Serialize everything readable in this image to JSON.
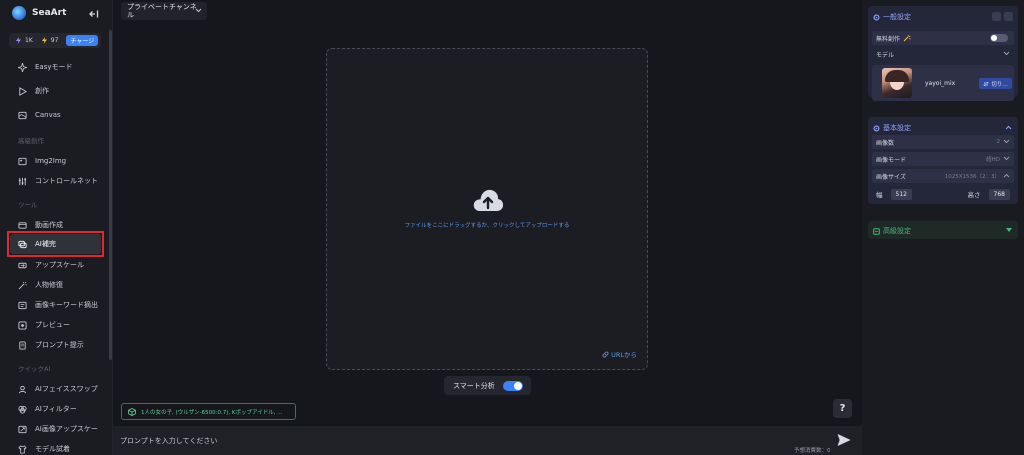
{
  "sidebar": {
    "brand": "SeaArt",
    "stats": {
      "stamina": "1K",
      "energy": "97",
      "charge_label": "チャージ"
    },
    "items": [
      {
        "label": "Easyモード"
      },
      {
        "label": "創作"
      },
      {
        "label": "Canvas"
      },
      {
        "label": "Img2Img"
      },
      {
        "label": "コントロールネット"
      },
      {
        "label": "動画作成"
      },
      {
        "label": "AI補完"
      },
      {
        "label": "アップスケール"
      },
      {
        "label": "人物修復"
      },
      {
        "label": "画像キーワード摘出"
      },
      {
        "label": "プレビュー"
      },
      {
        "label": "プロンプト提示"
      },
      {
        "label": "AIフェイススワップ"
      },
      {
        "label": "AIフィルター"
      },
      {
        "label": "AI画像アップスケー"
      },
      {
        "label": "モデル試着"
      }
    ],
    "sections": {
      "advanced": "高級創作",
      "tools": "ツール",
      "quick_ai": "クイックAI"
    }
  },
  "topbar": {
    "channel": "プライベートチャンネル"
  },
  "upload": {
    "hint": "ファイルをここにドラッグするか、クリックしてアップロードする",
    "url_label": "URLから"
  },
  "smart_analysis": {
    "label": "スマート分析",
    "enabled": true
  },
  "help": {
    "label": "?"
  },
  "suggestion": {
    "text": "1人の女の子, (ウルザン-6500:0.7), Kポップアイドル, ..."
  },
  "prompt": {
    "placeholder": "プロンプトを入力してください",
    "credits": "予想消費数：0"
  },
  "right_panel": {
    "general": {
      "title": "一般設定",
      "free_creation": "無料創作",
      "model_label": "モデル",
      "model_name": "yayoi_mix",
      "switch_label": "切り…"
    },
    "basic": {
      "title": "基本設定",
      "image_count_label": "画像数",
      "image_count": "2",
      "image_mode_label": "画像モード",
      "image_mode": "超HD",
      "image_size_label": "画像サイズ",
      "image_size": "1025X1536（2：3）",
      "width_label": "幅",
      "width": "512",
      "height_label": "高さ",
      "height": "768"
    },
    "advanced": {
      "title": "高級設定"
    }
  },
  "colors": {
    "accent": "#3b82f6",
    "highlight": "#e0262e",
    "link": "#5b9bf2",
    "success": "#47b87a"
  }
}
